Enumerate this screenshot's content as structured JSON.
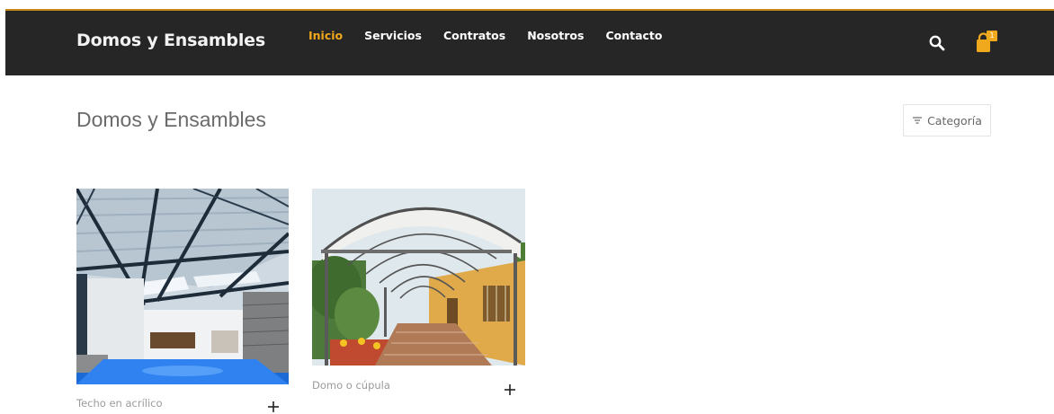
{
  "header": {
    "brand": "Domos y Ensambles",
    "nav": [
      {
        "label": "Inicio",
        "active": true
      },
      {
        "label": "Servicios",
        "active": false
      },
      {
        "label": "Contratos",
        "active": false
      },
      {
        "label": "Nosotros",
        "active": false
      },
      {
        "label": "Contacto",
        "active": false
      }
    ],
    "search_icon": "search-icon",
    "cart_icon": "shopping-bag-icon",
    "cart_count": "1",
    "accent_color": "#f0a81c",
    "background_color": "#262626"
  },
  "main": {
    "title": "Domos y Ensambles",
    "filter": {
      "label": "Categoría",
      "icon": "filter-icon"
    }
  },
  "products": [
    {
      "name": "Techo en acrílico",
      "image": "steel-roof-warehouse-photo",
      "action_icon": "plus-icon"
    },
    {
      "name": "Domo o cúpula",
      "image": "arched-canopy-corridor-photo",
      "action_icon": "plus-icon"
    }
  ]
}
